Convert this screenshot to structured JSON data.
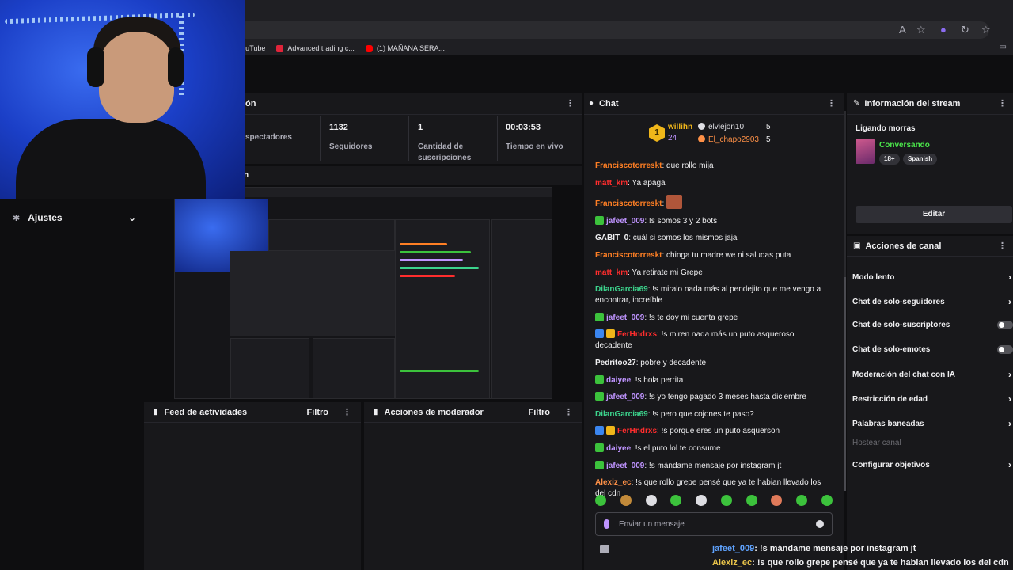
{
  "browser": {
    "bookmarks": [
      {
        "label": "YouTube",
        "color": "#ffffff"
      },
      {
        "label": "Advanced trading c...",
        "color": "#e0243a"
      },
      {
        "label": "(1) MAÑANA SERA...",
        "color": "#ff0000"
      }
    ]
  },
  "nav": {
    "settings_label": "Ajustes"
  },
  "stats": {
    "title_suffix": "ón",
    "items": [
      {
        "value": "",
        "label": "spectadores"
      },
      {
        "value": "1132",
        "label": "Seguidores"
      },
      {
        "value": "1",
        "label": "Cantidad de suscripciones"
      },
      {
        "value": "00:03:53",
        "label": "Tiempo en vivo"
      }
    ]
  },
  "preview": {
    "title_suffix": "n"
  },
  "activity": {
    "title": "Feed de actividades",
    "filter": "Filtro"
  },
  "moderator": {
    "title": "Acciones de moderador",
    "filter": "Filtro"
  },
  "chat": {
    "title": "Chat",
    "leaderboard": {
      "first_name": "willihn",
      "first_count": "24",
      "rank": "1",
      "others": [
        {
          "name": "elviejon10",
          "count": "5",
          "color": "#dedee3"
        },
        {
          "name": "El_chapo2903",
          "count": "5",
          "color": "#ff9147"
        }
      ]
    },
    "messages": [
      {
        "user": "Franciscotorreskt",
        "color": "#ff7f24",
        "text": ": que rollo mija",
        "badge": ""
      },
      {
        "user": "matt_km",
        "color": "#ff2d2d",
        "text": ": Ya apaga",
        "badge": ""
      },
      {
        "user": "Franciscotorreskt",
        "color": "#ff7f24",
        "text": ":",
        "badge": "",
        "emote": true
      },
      {
        "user": "jafeet_009",
        "color": "#bf94ff",
        "text": ": !s somos 3 y 2 bots",
        "badge": "#3cc23c"
      },
      {
        "user": "GABIT_0",
        "color": "#efeff1",
        "text": ": cuál si somos los mismos jaja",
        "badge": ""
      },
      {
        "user": "Franciscotorreskt",
        "color": "#ff7f24",
        "text": ": chinga tu madre we ni saludas puta",
        "badge": ""
      },
      {
        "user": "matt_km",
        "color": "#ff2d2d",
        "text": ": Ya retirate mi Grepe",
        "badge": ""
      },
      {
        "user": "DilanGarcia69",
        "color": "#3cd48d",
        "text": ": !s miralo nada más al pendejito que me vengo a encontrar, increíble",
        "badge": ""
      },
      {
        "user": "jafeet_009",
        "color": "#bf94ff",
        "text": ": !s te doy mi cuenta grepe",
        "badge": "#3cc23c"
      },
      {
        "user": "FerHndrxs",
        "color": "#ff2d2d",
        "text": ": !s miren nada más un puto asqueroso decadente",
        "badge": "#3b86f0",
        "badge2": "#f0b61a"
      },
      {
        "user": "Pedritoo27",
        "color": "#efeff1",
        "text": ": pobre y decadente",
        "badge": ""
      },
      {
        "user": "daiyee",
        "color": "#bf94ff",
        "text": ": !s hola perrita",
        "badge": "#3cc23c"
      },
      {
        "user": "jafeet_009",
        "color": "#bf94ff",
        "text": ": !s yo tengo pagado 3 meses hasta diciembre",
        "badge": "#3cc23c"
      },
      {
        "user": "DilanGarcia69",
        "color": "#3cd48d",
        "text": ": !s pero que cojones te paso?",
        "badge": ""
      },
      {
        "user": "FerHndrxs",
        "color": "#ff2d2d",
        "text": ": !s porque eres un puto asquerson",
        "badge": "#3b86f0",
        "badge2": "#f0b61a"
      },
      {
        "user": "daiyee",
        "color": "#bf94ff",
        "text": ": !s el puto lol te consume",
        "badge": "#3cc23c"
      },
      {
        "user": "jafeet_009",
        "color": "#bf94ff",
        "text": ": !s mándame mensaje por instagram jt",
        "badge": "#3cc23c"
      },
      {
        "user": "Alexiz_ec",
        "color": "#ff9147",
        "text": ": !s que rollo grepe pensé que ya te habian llevado los del cdn",
        "badge": ""
      }
    ],
    "input_placeholder": "Enviar un mensaje"
  },
  "stream_info": {
    "title": "Información del stream",
    "stream_title": "Ligando morras",
    "category": "Conversando",
    "tags": [
      "18+",
      "Spanish"
    ],
    "edit_label": "Editar"
  },
  "channel_actions": {
    "title": "Acciones de canal",
    "items": [
      {
        "label": "Modo lento",
        "control": "chevron"
      },
      {
        "label": "Chat de solo-seguidores",
        "control": "chevron"
      },
      {
        "label": "Chat de solo-suscriptores",
        "control": "toggle"
      },
      {
        "label": "Chat de solo-emotes",
        "control": "toggle"
      },
      {
        "label": "Moderación del chat con IA",
        "control": "chevron"
      },
      {
        "label": "Restricción de edad",
        "control": "chevron"
      },
      {
        "label": "Palabras baneadas",
        "control": "chevron"
      },
      {
        "label": "Hostear canal",
        "control": "disabled"
      },
      {
        "label": "Configurar objetivos",
        "control": "chevron"
      }
    ]
  },
  "overlay": {
    "line1_user": "jafeet_009",
    "line1_text": ": !s mándame mensaje por instagram jt",
    "line2_user": "Alexiz_ec",
    "line2_text": ": !s que rollo grepe pensé que ya te habian llevado los del cdn"
  }
}
